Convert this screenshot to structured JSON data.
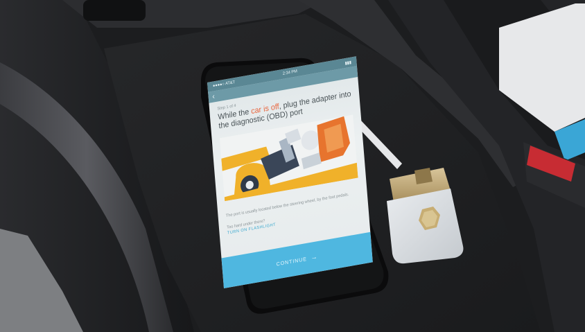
{
  "screen": {
    "status_left": "●●●●○ AT&T",
    "status_center": "2:34 PM",
    "status_right": "▮▮▮",
    "step_label": "Step 1 of 4",
    "headline_before": "While the ",
    "headline_accent": "car is off",
    "headline_after": ", plug the adapter into the diagnostic (OBD) port",
    "body_text": "The port is usually located below the steering wheel, by the foot pedals.",
    "link_question": "Too hard under there?",
    "link_text": "TURN ON FLASHLIGHT",
    "continue_label": "CONTINUE"
  },
  "colors": {
    "accent": "#e8643b",
    "button": "#4fb7e0",
    "link": "#3aa9cf"
  },
  "icons": [
    "back-icon",
    "arrow-right-icon"
  ]
}
